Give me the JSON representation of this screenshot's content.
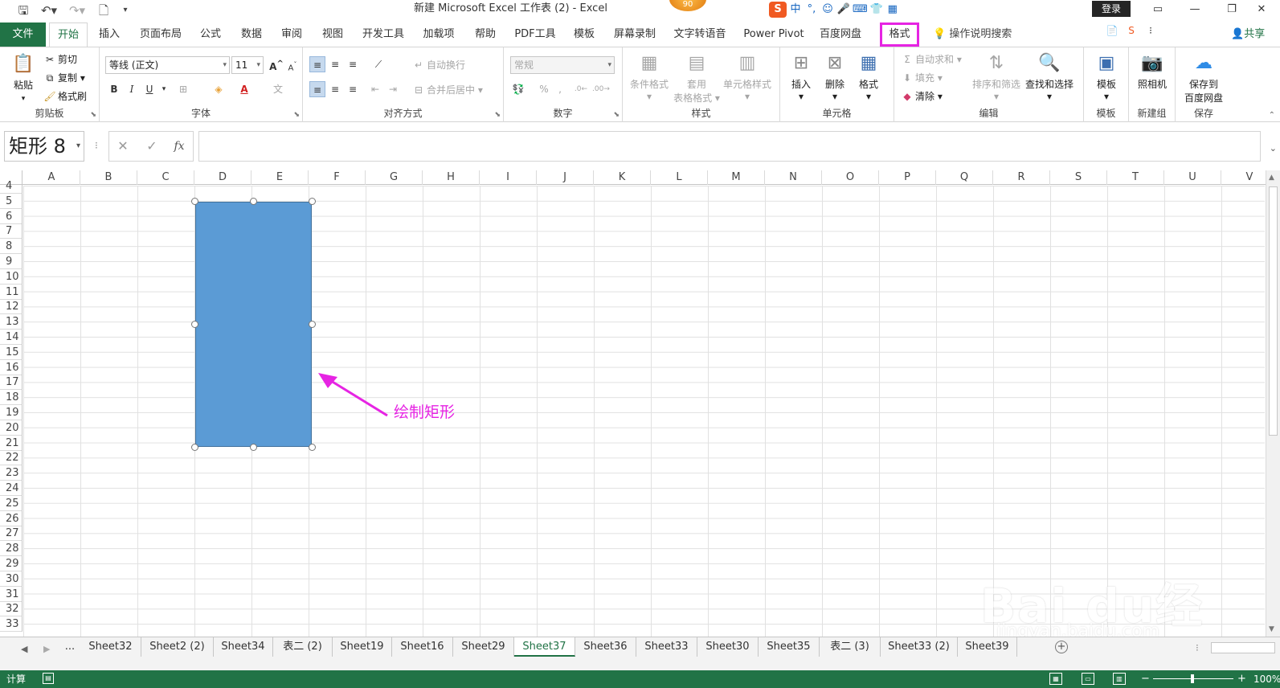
{
  "window": {
    "title": "新建 Microsoft Excel 工作表 (2)  -  Excel",
    "badge": "90",
    "login": "登录",
    "ime": [
      "S",
      "中",
      "°,",
      "☺",
      "🎤",
      "⌨",
      "👕",
      "▦"
    ]
  },
  "ribbon_tabs": {
    "file": "文件",
    "items": [
      "开始",
      "插入",
      "页面布局",
      "公式",
      "数据",
      "审阅",
      "视图",
      "开发工具",
      "加载项",
      "帮助",
      "PDF工具",
      "模板",
      "屏幕录制",
      "文字转语音",
      "Power Pivot",
      "百度网盘",
      "格式"
    ],
    "active": "开始",
    "highlighted": "格式",
    "tell_me": "操作说明搜索",
    "share": "共享"
  },
  "ribbon": {
    "clipboard": {
      "label": "剪贴板",
      "paste": "粘贴",
      "cut": "剪切",
      "copy": "复制",
      "format_painter": "格式刷"
    },
    "font": {
      "label": "字体",
      "name": "等线 (正文)",
      "size": "11",
      "bold": "B",
      "italic": "I",
      "underline": "U",
      "grow": "A",
      "shrink": "A"
    },
    "alignment": {
      "label": "对齐方式",
      "wrap": "自动换行",
      "merge": "合并后居中"
    },
    "number": {
      "label": "数字",
      "format": "常规",
      "percent": "%",
      "comma": ","
    },
    "styles": {
      "label": "样式",
      "conditional": "条件格式",
      "table_line1": "套用",
      "table_line2": "表格格式",
      "cell_styles": "单元格样式"
    },
    "cells": {
      "label": "单元格",
      "insert": "插入",
      "delete": "删除",
      "format": "格式"
    },
    "editing": {
      "label": "编辑",
      "autosum": "自动求和",
      "fill": "填充",
      "clear": "清除",
      "sort": "排序和筛选",
      "find": "查找和选择"
    },
    "template": {
      "label": "模板",
      "button": "模板"
    },
    "newgroup": {
      "label": "新建组",
      "button": "照相机"
    },
    "save": {
      "label": "保存",
      "line1": "保存到",
      "line2": "百度网盘"
    }
  },
  "formula_bar": {
    "name_box": "矩形 8",
    "fx": "fx",
    "value": ""
  },
  "grid": {
    "columns": [
      "A",
      "B",
      "C",
      "D",
      "E",
      "F",
      "G",
      "H",
      "I",
      "J",
      "K",
      "L",
      "M",
      "N",
      "O",
      "P",
      "Q",
      "R",
      "S",
      "T",
      "U",
      "V"
    ],
    "rows": [
      "4",
      "5",
      "6",
      "7",
      "8",
      "9",
      "10",
      "11",
      "12",
      "13",
      "14",
      "15",
      "16",
      "17",
      "18",
      "19",
      "20",
      "21",
      "22",
      "23",
      "24",
      "25",
      "26",
      "27",
      "28",
      "29",
      "30",
      "31",
      "32",
      "33"
    ],
    "shape_color": "#5b9bd5"
  },
  "annotation": {
    "text": "绘制矩形",
    "color": "#e624e3"
  },
  "watermark": {
    "text": "Bai du经验",
    "url": "jingyan.baidu.com"
  },
  "sheet_tabs": {
    "ellipsis": "...",
    "items": [
      "Sheet32",
      "Sheet2 (2)",
      "Sheet34",
      "表二 (2)",
      "Sheet19",
      "Sheet16",
      "Sheet29",
      "Sheet37",
      "Sheet36",
      "Sheet33",
      "Sheet30",
      "Sheet35",
      "表二 (3)",
      "Sheet33 (2)",
      "Sheet39"
    ],
    "active": "Sheet37"
  },
  "status": {
    "mode": "计算",
    "zoom": "100%"
  },
  "colors": {
    "excel_green": "#217346",
    "highlight": "#e624e3"
  }
}
